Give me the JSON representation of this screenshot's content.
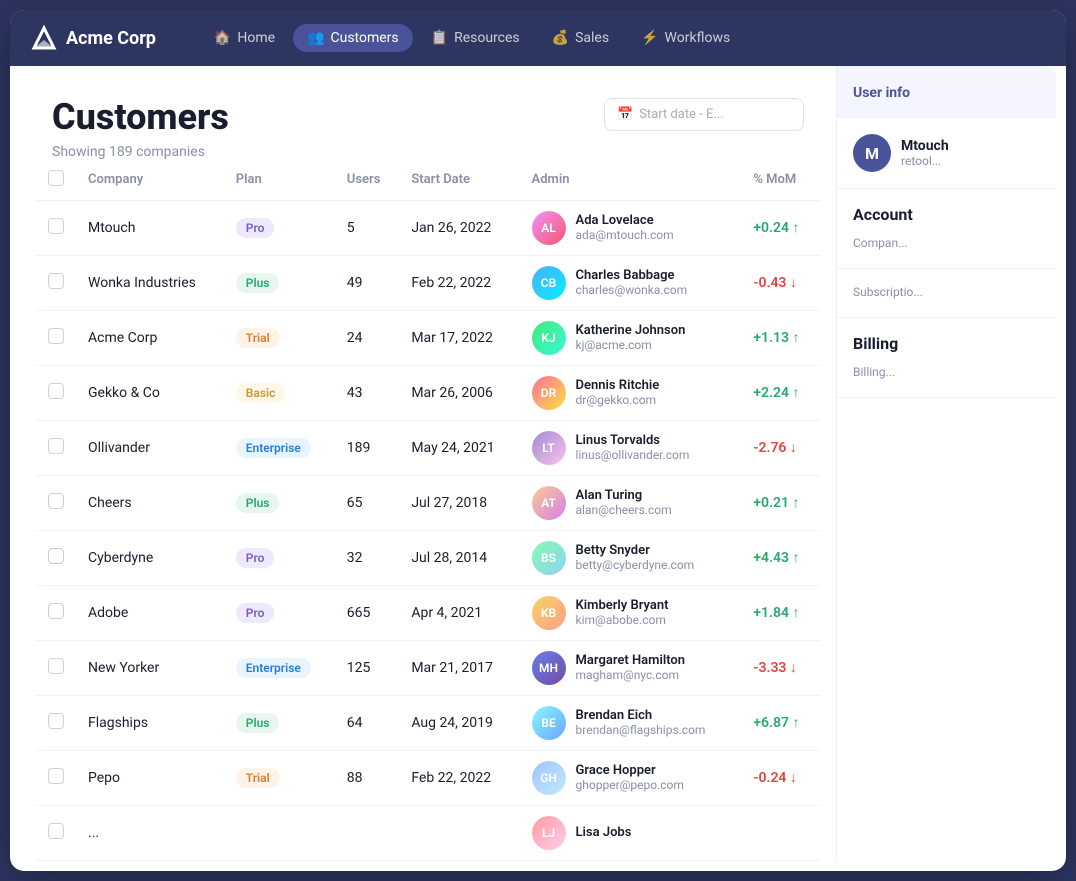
{
  "app": {
    "title": "Acme Corp",
    "logo_text": "A"
  },
  "nav": {
    "items": [
      {
        "id": "home",
        "label": "Home",
        "icon": "🏠",
        "active": false
      },
      {
        "id": "customers",
        "label": "Customers",
        "icon": "👥",
        "active": true
      },
      {
        "id": "resources",
        "label": "Resources",
        "icon": "📋",
        "active": false
      },
      {
        "id": "sales",
        "label": "Sales",
        "icon": "💰",
        "active": false
      },
      {
        "id": "workflows",
        "label": "Workflows",
        "icon": "⚡",
        "active": false
      }
    ]
  },
  "page": {
    "title": "Customers",
    "subtitle": "Showing 189 companies",
    "filter_placeholder": "Start date - E..."
  },
  "table": {
    "columns": [
      "",
      "Company",
      "Plan",
      "Users",
      "Start Date",
      "Admin",
      "% MoM"
    ],
    "rows": [
      {
        "company": "Mtouch",
        "plan": "Pro",
        "plan_class": "plan-pro",
        "users": "5",
        "start_date": "Jan 26, 2022",
        "admin_name": "Ada Lovelace",
        "admin_email": "ada@mtouch.com",
        "mom": "+0.24",
        "mom_class": "mom-positive arrow-up",
        "avatar_class": "av-ada",
        "avatar_initials": "AL"
      },
      {
        "company": "Wonka Industries",
        "plan": "Plus",
        "plan_class": "plan-plus",
        "users": "49",
        "start_date": "Feb 22, 2022",
        "admin_name": "Charles Babbage",
        "admin_email": "charles@wonka.com",
        "mom": "-0.43",
        "mom_class": "mom-negative arrow-down",
        "avatar_class": "av-charles",
        "avatar_initials": "CB"
      },
      {
        "company": "Acme Corp",
        "plan": "Trial",
        "plan_class": "plan-trial",
        "users": "24",
        "start_date": "Mar 17, 2022",
        "admin_name": "Katherine Johnson",
        "admin_email": "kj@acme.com",
        "mom": "+1.13",
        "mom_class": "mom-positive arrow-up",
        "avatar_class": "av-katherine",
        "avatar_initials": "KJ"
      },
      {
        "company": "Gekko & Co",
        "plan": "Basic",
        "plan_class": "plan-basic",
        "users": "43",
        "start_date": "Mar 26, 2006",
        "admin_name": "Dennis Ritchie",
        "admin_email": "dr@gekko.com",
        "mom": "+2.24",
        "mom_class": "mom-positive arrow-up",
        "avatar_class": "av-dennis",
        "avatar_initials": "DR"
      },
      {
        "company": "Ollivander",
        "plan": "Enterprise",
        "plan_class": "plan-enterprise",
        "users": "189",
        "start_date": "May 24, 2021",
        "admin_name": "Linus Torvalds",
        "admin_email": "linus@ollivander.com",
        "mom": "-2.76",
        "mom_class": "mom-negative arrow-down",
        "avatar_class": "av-linus",
        "avatar_initials": "LT"
      },
      {
        "company": "Cheers",
        "plan": "Plus",
        "plan_class": "plan-plus",
        "users": "65",
        "start_date": "Jul 27, 2018",
        "admin_name": "Alan Turing",
        "admin_email": "alan@cheers.com",
        "mom": "+0.21",
        "mom_class": "mom-positive arrow-up",
        "avatar_class": "av-alan",
        "avatar_initials": "AT"
      },
      {
        "company": "Cyberdyne",
        "plan": "Pro",
        "plan_class": "plan-pro",
        "users": "32",
        "start_date": "Jul 28, 2014",
        "admin_name": "Betty Snyder",
        "admin_email": "betty@cyberdyne.com",
        "mom": "+4.43",
        "mom_class": "mom-positive arrow-up",
        "avatar_class": "av-betty",
        "avatar_initials": "BS"
      },
      {
        "company": "Adobe",
        "plan": "Pro",
        "plan_class": "plan-pro",
        "users": "665",
        "start_date": "Apr 4, 2021",
        "admin_name": "Kimberly Bryant",
        "admin_email": "kim@abobe.com",
        "mom": "+1.84",
        "mom_class": "mom-positive arrow-up",
        "avatar_class": "av-kimberly",
        "avatar_initials": "KB"
      },
      {
        "company": "New Yorker",
        "plan": "Enterprise",
        "plan_class": "plan-enterprise",
        "users": "125",
        "start_date": "Mar 21, 2017",
        "admin_name": "Margaret Hamilton",
        "admin_email": "magham@nyc.com",
        "mom": "-3.33",
        "mom_class": "mom-negative arrow-down",
        "avatar_class": "av-margaret",
        "avatar_initials": "MH"
      },
      {
        "company": "Flagships",
        "plan": "Plus",
        "plan_class": "plan-plus",
        "users": "64",
        "start_date": "Aug 24, 2019",
        "admin_name": "Brendan Eich",
        "admin_email": "brendan@flagships.com",
        "mom": "+6.87",
        "mom_class": "mom-positive arrow-up",
        "avatar_class": "av-brendan",
        "avatar_initials": "BE"
      },
      {
        "company": "Pepo",
        "plan": "Trial",
        "plan_class": "plan-trial",
        "users": "88",
        "start_date": "Feb 22, 2022",
        "admin_name": "Grace Hopper",
        "admin_email": "ghopper@pepo.com",
        "mom": "-0.24",
        "mom_class": "mom-negative arrow-down",
        "avatar_class": "av-grace",
        "avatar_initials": "GH"
      },
      {
        "company": "...",
        "plan": "",
        "plan_class": "",
        "users": "",
        "start_date": "",
        "admin_name": "Lisa Jobs",
        "admin_email": "",
        "mom": "",
        "mom_class": "",
        "avatar_class": "av-lisa",
        "avatar_initials": "LJ"
      }
    ]
  },
  "right_panel": {
    "tab_label": "User info",
    "user": {
      "initial": "M",
      "company": "Mtouch",
      "sub": "retool..."
    },
    "account_section_title": "Account",
    "company_field_label": "Compan...",
    "subscription_field_label": "Subscriptio...",
    "billing_section_title": "Billing",
    "billing_field_label": "Billing..."
  }
}
